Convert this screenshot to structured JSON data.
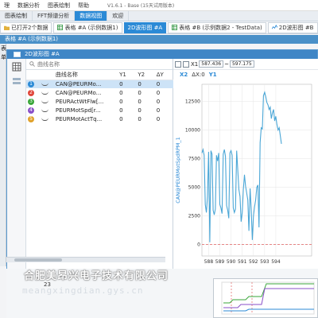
{
  "menu": {
    "items": [
      "理",
      "数据分析",
      "图表绘制",
      "帮助"
    ],
    "version": "V1.6.1 - Base  (15天试用版本)"
  },
  "main_tabs": [
    "图表绘制",
    "FFT频谱分析",
    "数据视图",
    "欢迎"
  ],
  "main_tab_active": 2,
  "doc_tabs": [
    {
      "label": "已打开2个数据",
      "active": false,
      "icon": "folder-icon"
    },
    {
      "label": "表格 #A (示例数据1)",
      "active": false,
      "icon": "table-icon"
    },
    {
      "label": "2D波形图 #A",
      "active": true,
      "icon": "chart-icon"
    },
    {
      "label": "表格 #B (示例数据2 - TestData)",
      "active": false,
      "icon": "table-icon"
    },
    {
      "label": "2D波形图 #B",
      "active": false,
      "icon": "chart-icon"
    }
  ],
  "blue_bar": "表格 #A (示例数据1)",
  "left_edge_labels": [
    "表",
    "单"
  ],
  "window_title": "2D波形图 #A",
  "search": {
    "placeholder": "曲线名称"
  },
  "curve_table": {
    "headers": [
      "",
      "",
      "曲线名称",
      "Y1",
      "Y2",
      "ΔY"
    ],
    "rows": [
      {
        "num": "1",
        "color": "#2b8ad6",
        "name": "CAN@PEURMo...",
        "y1": "0",
        "y2": "0",
        "dy": "0",
        "selected": true
      },
      {
        "num": "2",
        "color": "#e0463a",
        "name": "CAN@PEURMo...",
        "y1": "0",
        "y2": "0",
        "dy": "0",
        "selected": false
      },
      {
        "num": "3",
        "color": "#3aa63a",
        "name": "PEURActWtFlw[...",
        "y1": "0",
        "y2": "0",
        "dy": "0",
        "selected": false
      },
      {
        "num": "4",
        "color": "#8a4fc8",
        "name": "PEURMotSpd[r...",
        "y1": "0",
        "y2": "0",
        "dy": "0",
        "selected": false
      },
      {
        "num": "5",
        "color": "#e0a12a",
        "name": "PEURMotActTq...",
        "y1": "0",
        "y2": "0",
        "dy": "0",
        "selected": false
      }
    ]
  },
  "plot_toolbar": {
    "x_label": "X1",
    "x1_value": "587.436",
    "x_sep": "~",
    "x2_value": "597.175",
    "x2_label": "X2",
    "dx_label": "ΔX:0",
    "y_label": "Y1"
  },
  "page_number": "23",
  "watermark": {
    "line1": "合肥美昂兴电子技术有限公司",
    "line2": "meangxingdian.gys.cn"
  },
  "chart_data": {
    "type": "line",
    "title": "",
    "xlabel": "",
    "ylabel": "CAN@PEURMotSpdRPM_1",
    "xlim": [
      587.4,
      597.2
    ],
    "ylim": [
      -1000,
      14000
    ],
    "x_ticks": [
      588,
      589,
      590,
      591,
      592,
      593,
      594
    ],
    "y_ticks": [
      0,
      2500,
      5000,
      7500,
      10000,
      12500
    ],
    "grid": true,
    "reference_line": {
      "y": 0,
      "style": "dashed",
      "color": "#e06060"
    },
    "series": [
      {
        "color": "#4aa6d6",
        "x": [
          587.4,
          587.5,
          587.6,
          587.7,
          587.8,
          587.9,
          588.0,
          588.1,
          588.2,
          588.3,
          588.4,
          588.5,
          588.6,
          588.7,
          588.8,
          588.9,
          589.0,
          589.1,
          589.2,
          589.3,
          589.4,
          589.5,
          589.6,
          589.7,
          589.8,
          589.9,
          590.0,
          590.1,
          590.2,
          590.3,
          590.4,
          590.5,
          590.6,
          590.7,
          590.8,
          590.9,
          591.0,
          591.1,
          591.2,
          591.3,
          591.4,
          591.5,
          591.6,
          591.7,
          591.8,
          591.9,
          592.0,
          592.1,
          592.2,
          592.3,
          592.4,
          592.5,
          592.6,
          592.7,
          592.8,
          592.9,
          593.0,
          593.1,
          593.2,
          593.3,
          593.4,
          593.5,
          593.6,
          593.7,
          593.8,
          593.9,
          594.0,
          594.1,
          594.2,
          594.3,
          594.4,
          594.5
        ],
        "y": [
          8000,
          8300,
          7800,
          3500,
          2800,
          4200,
          8100,
          200,
          8200,
          7900,
          3000,
          2600,
          3100,
          7800,
          7300,
          8000,
          3500,
          3200,
          2700,
          7900,
          8300,
          7700,
          3400,
          3000,
          2300,
          8000,
          8200,
          7800,
          3200,
          2800,
          3100,
          8200,
          6500,
          4800,
          4200,
          2000,
          2800,
          4800,
          6100,
          5100,
          4500,
          3900,
          1200,
          4900,
          3100,
          400,
          2500,
          3300,
          3900,
          5000,
          5200,
          1500,
          8900,
          10200,
          10100,
          13000,
          13300,
          12900,
          12400,
          12200,
          11800,
          12000,
          11000,
          11500,
          11800,
          10800,
          11200,
          10500,
          10000,
          10200,
          9500,
          8800
        ]
      }
    ]
  }
}
